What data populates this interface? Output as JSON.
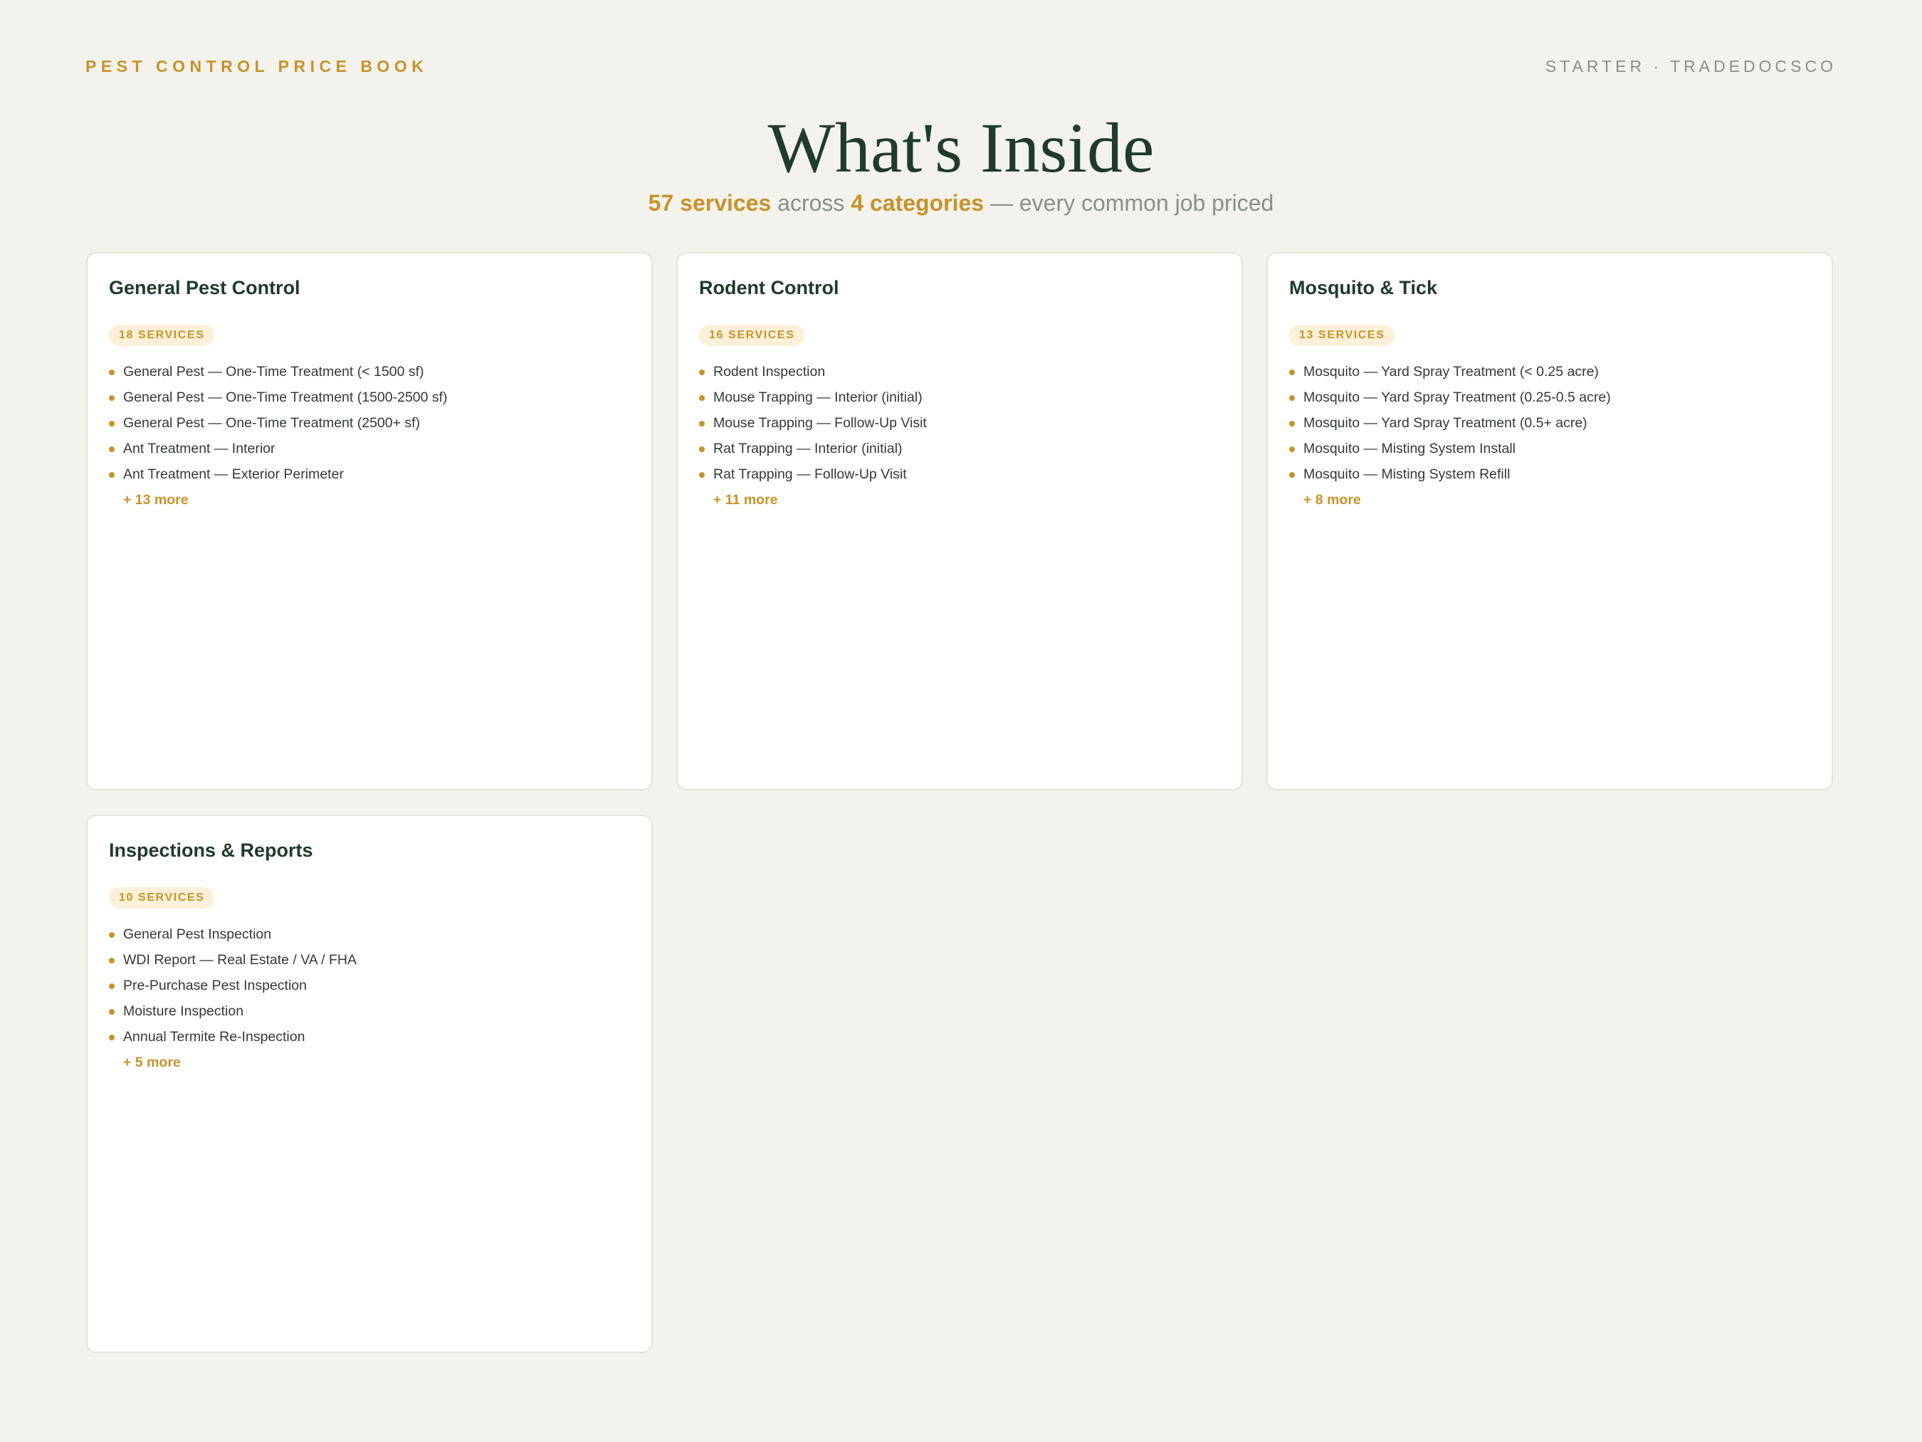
{
  "header": {
    "brand": "PEST CONTROL PRICE BOOK",
    "meta": "STARTER · TRADEDOCSCO"
  },
  "title": "What's Inside",
  "subtitle": {
    "services": "57 services",
    "across": "across",
    "categories": "4 categories",
    "tail": "— every common job priced"
  },
  "categories": [
    {
      "title": "General Pest Control",
      "badge": "18 SERVICES",
      "items": [
        "General Pest — One-Time Treatment (< 1500 sf)",
        "General Pest — One-Time Treatment (1500-2500 sf)",
        "General Pest — One-Time Treatment (2500+ sf)",
        "Ant Treatment — Interior",
        "Ant Treatment — Exterior Perimeter"
      ],
      "more": "+ 13 more"
    },
    {
      "title": "Rodent Control",
      "badge": "16 SERVICES",
      "items": [
        "Rodent Inspection",
        "Mouse Trapping — Interior (initial)",
        "Mouse Trapping — Follow-Up Visit",
        "Rat Trapping — Interior (initial)",
        "Rat Trapping — Follow-Up Visit"
      ],
      "more": "+ 11 more"
    },
    {
      "title": "Mosquito & Tick",
      "badge": "13 SERVICES",
      "items": [
        "Mosquito — Yard Spray Treatment (< 0.25 acre)",
        "Mosquito — Yard Spray Treatment (0.25-0.5 acre)",
        "Mosquito — Yard Spray Treatment (0.5+ acre)",
        "Mosquito — Misting System Install",
        "Mosquito — Misting System Refill"
      ],
      "more": "+ 8 more"
    },
    {
      "title": "Inspections & Reports",
      "badge": "10 SERVICES",
      "items": [
        "General Pest Inspection",
        "WDI Report — Real Estate / VA / FHA",
        "Pre-Purchase Pest Inspection",
        "Moisture Inspection",
        "Annual Termite Re-Inspection"
      ],
      "more": "+ 5 more"
    }
  ]
}
